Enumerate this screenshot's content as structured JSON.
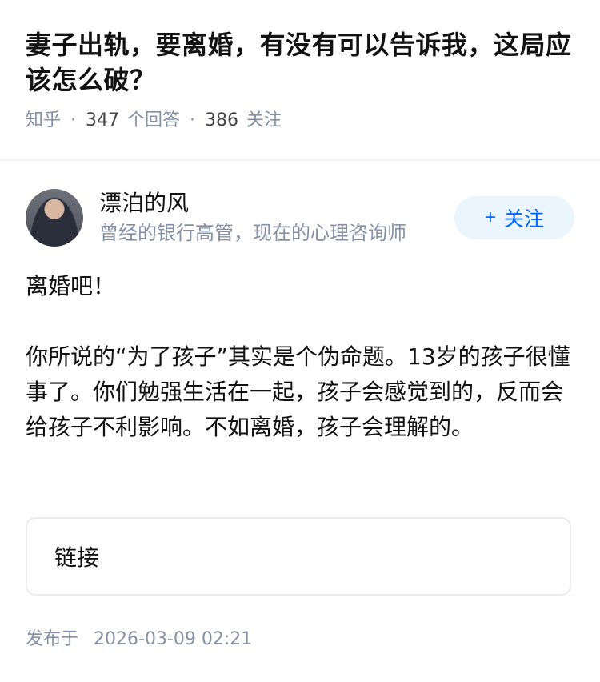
{
  "question": {
    "title": "妻子出轨，要离婚，有没有可以告诉我，这局应该怎么破？",
    "source": "知乎",
    "separator": "·",
    "answers_count": "347",
    "answers_label": "个回答",
    "followers_count": "386",
    "followers_label": "关注"
  },
  "author": {
    "name": "漂泊的风",
    "bio": "曾经的银行高管，现在的心理咨询师",
    "follow_plus": "+",
    "follow_label": "关注"
  },
  "answer": {
    "paragraphs": [
      "离婚吧！",
      "你所说的“为了孩子”其实是个伪命题。13岁的孩子很懂事了。你们勉强生活在一起，孩子会感觉到的，反而会给孩子不利影响。不如离婚，孩子会理解的。"
    ]
  },
  "link_card": {
    "label": "链接"
  },
  "publish": {
    "label": "发布于",
    "datetime": "2026-03-09 02:21"
  }
}
